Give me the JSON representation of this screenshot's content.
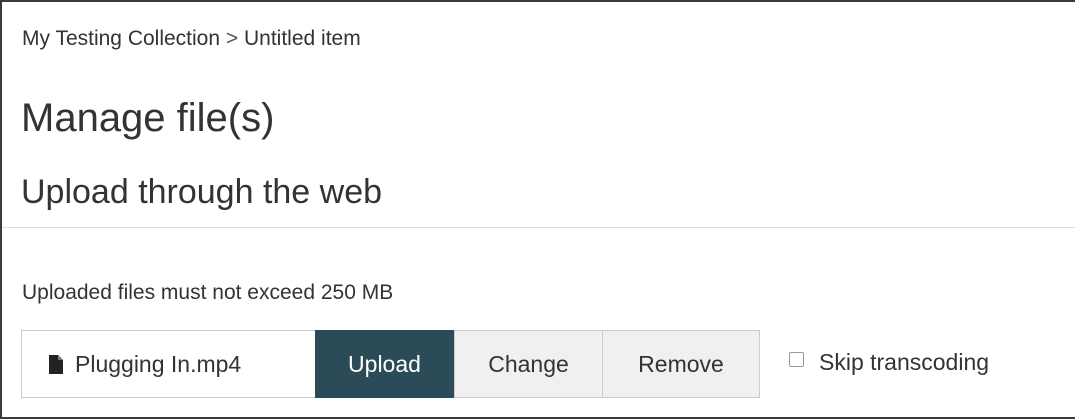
{
  "breadcrumb": {
    "collection": "My Testing Collection",
    "separator": ">",
    "item": "Untitled item"
  },
  "page_title": "Manage file(s)",
  "section_title": "Upload through the web",
  "help_text": "Uploaded files must not exceed 250 MB",
  "file_input": {
    "icon": "file-icon",
    "filename": "Plugging In.mp4",
    "upload_label": "Upload",
    "change_label": "Change",
    "remove_label": "Remove"
  },
  "options": {
    "skip_transcoding_label": "Skip transcoding",
    "skip_transcoding_checked": false
  },
  "colors": {
    "upload_button_bg": "#2a4b57",
    "secondary_button_bg": "#f0f0f0",
    "text": "#333333"
  }
}
